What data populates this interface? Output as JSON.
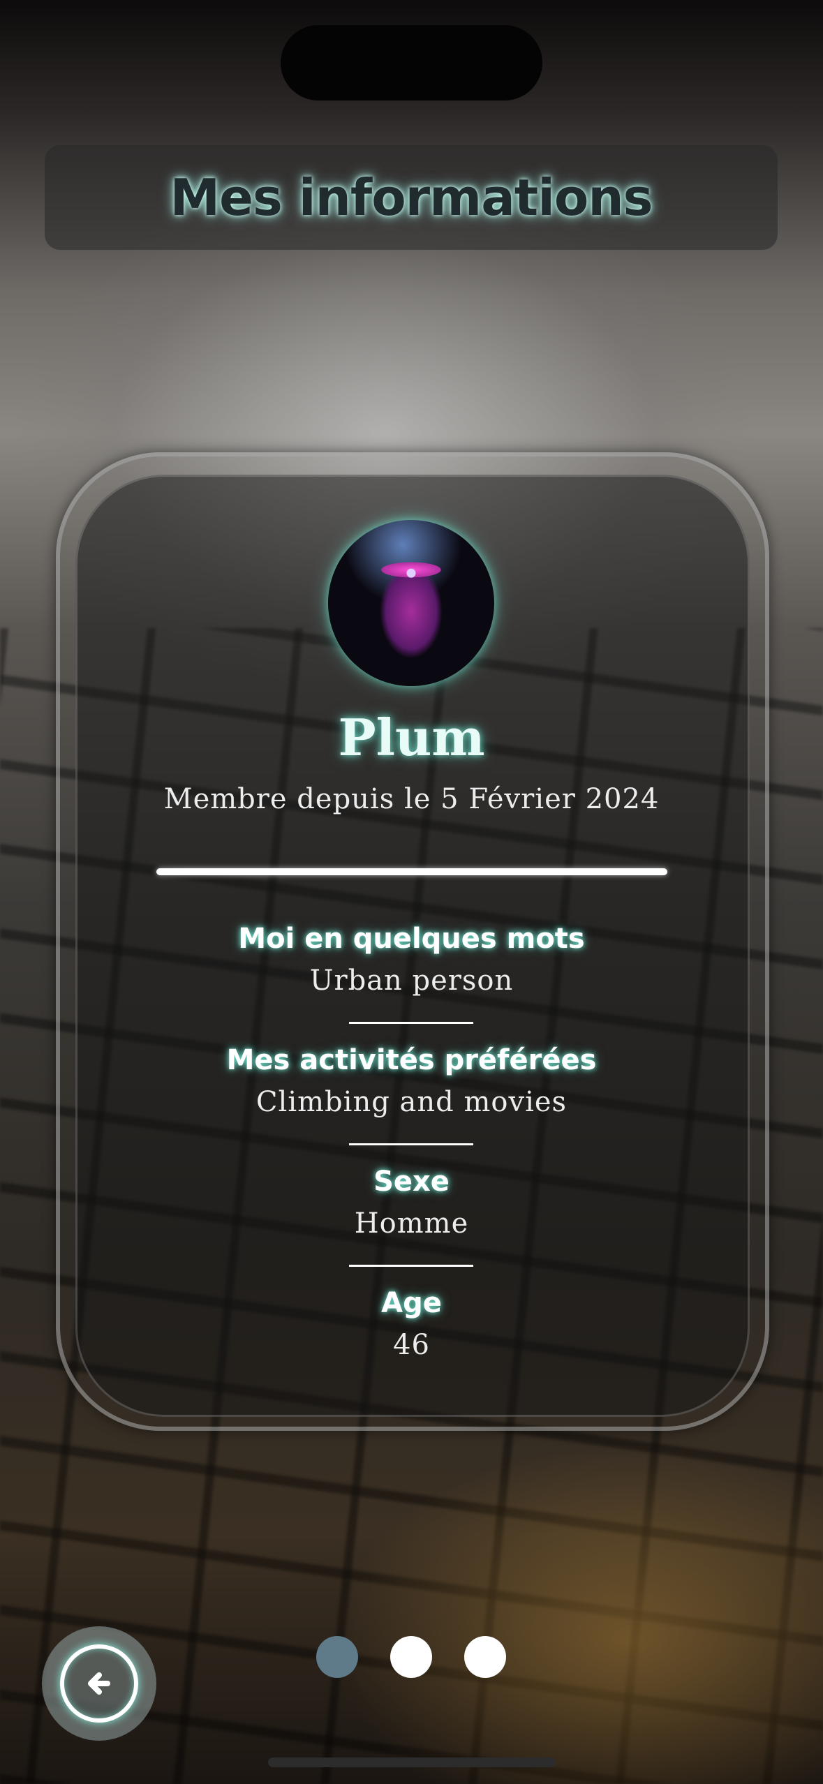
{
  "header": {
    "title": "Mes informations"
  },
  "profile": {
    "avatar_alt": "avatar",
    "name": "Plum",
    "member_since": "Membre depuis le 5 Février 2024"
  },
  "fields": [
    {
      "label": "Moi en quelques mots",
      "value": "Urban person"
    },
    {
      "label": "Mes activités préférées",
      "value": "Climbing and movies"
    },
    {
      "label": "Sexe",
      "value": "Homme"
    },
    {
      "label": "Age",
      "value": "46"
    }
  ],
  "navigation": {
    "back_icon": "arrow-left-circle-icon",
    "pages_total": 3,
    "current_page": 1
  },
  "colors": {
    "glow": "#78ffe6",
    "active_dot": "#5f7b8a",
    "inactive_dot": "#ffffff"
  }
}
